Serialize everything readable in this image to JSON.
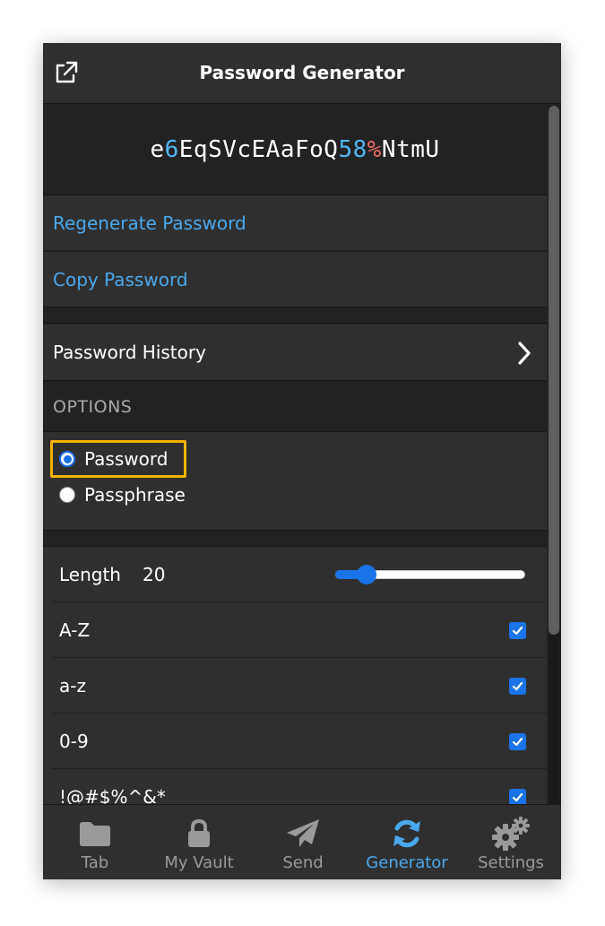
{
  "header": {
    "title": "Password Generator",
    "popout_icon": "popout-icon"
  },
  "password": {
    "segments": [
      {
        "text": "e",
        "kind": "letter"
      },
      {
        "text": "6",
        "kind": "number"
      },
      {
        "text": "EqSVcEAaFoQ",
        "kind": "letter"
      },
      {
        "text": "58",
        "kind": "number"
      },
      {
        "text": "%",
        "kind": "special"
      },
      {
        "text": "NtmU",
        "kind": "letter"
      }
    ]
  },
  "actions": {
    "regenerate_label": "Regenerate Password",
    "copy_label": "Copy Password"
  },
  "history": {
    "label": "Password History"
  },
  "options": {
    "heading": "OPTIONS",
    "type_options": [
      {
        "label": "Password",
        "selected": true
      },
      {
        "label": "Passphrase",
        "selected": false
      }
    ],
    "length": {
      "label": "Length",
      "value": "20",
      "min": 5,
      "max": 128
    },
    "checkboxes": [
      {
        "label": "A-Z",
        "checked": true
      },
      {
        "label": "a-z",
        "checked": true
      },
      {
        "label": "0-9",
        "checked": true
      },
      {
        "label": "!@#$%^&*",
        "checked": true
      }
    ]
  },
  "tabs": [
    {
      "label": "Tab",
      "icon": "folder-icon",
      "active": false
    },
    {
      "label": "My Vault",
      "icon": "lock-icon",
      "active": false
    },
    {
      "label": "Send",
      "icon": "paper-plane-icon",
      "active": false
    },
    {
      "label": "Generator",
      "icon": "refresh-icon",
      "active": true
    },
    {
      "label": "Settings",
      "icon": "gears-icon",
      "active": false
    }
  ],
  "colors": {
    "accent": "#4aa9ee",
    "number": "#52b6f5",
    "special": "#ef6e64",
    "focus": "#f5b400",
    "control": "#1a73e8"
  }
}
